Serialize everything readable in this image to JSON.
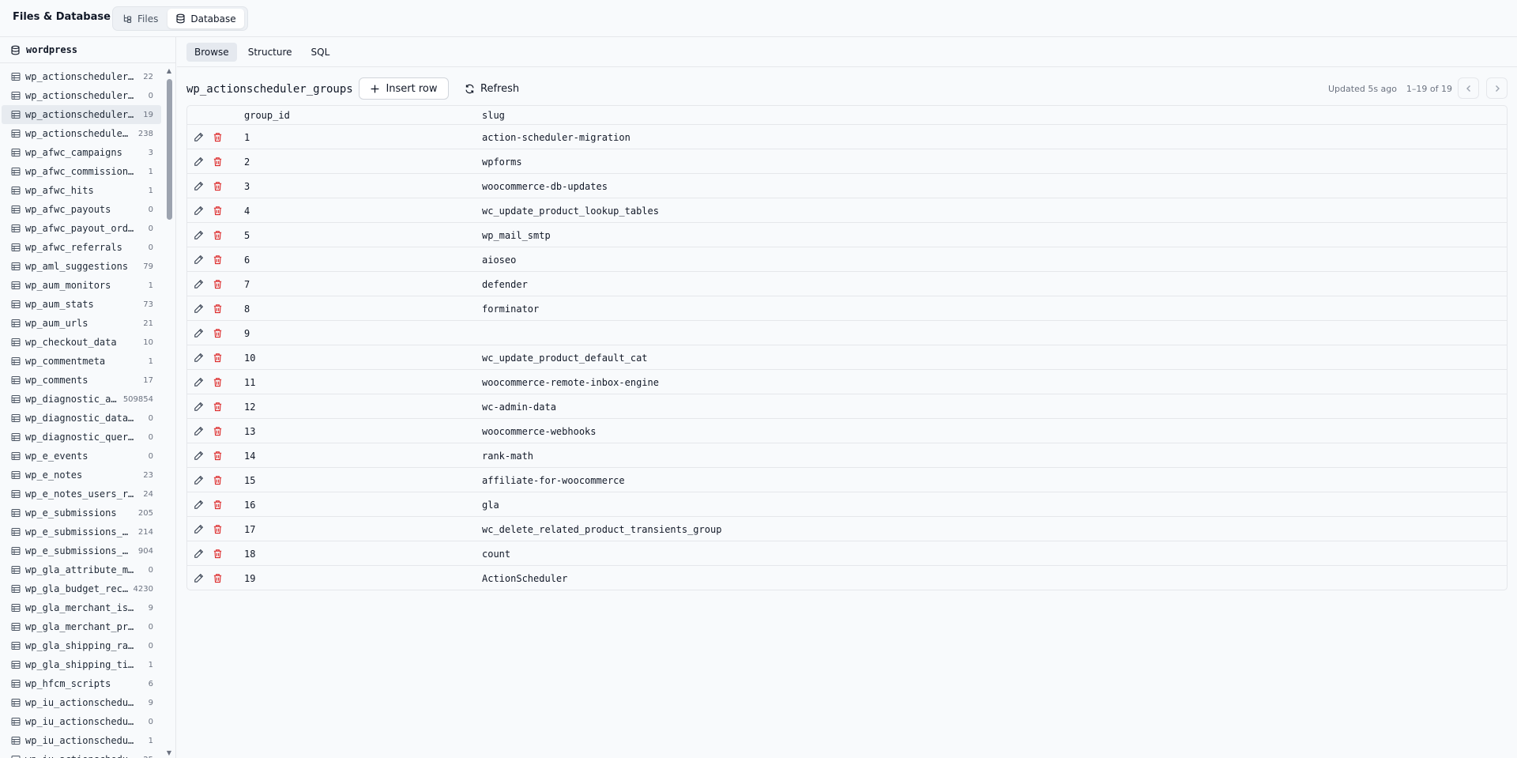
{
  "header": {
    "title": "Files & Database",
    "tabs": [
      {
        "label": "Files",
        "icon": "file-tree-icon",
        "active": false
      },
      {
        "label": "Database",
        "icon": "database-icon",
        "active": true
      }
    ]
  },
  "sidebar": {
    "database": "wordpress",
    "tables": [
      {
        "name": "wp_actionscheduler_actions",
        "count": "22"
      },
      {
        "name": "wp_actionscheduler_claims",
        "count": "0"
      },
      {
        "name": "wp_actionscheduler_groups",
        "count": "19",
        "active": true
      },
      {
        "name": "wp_actionscheduler_logs",
        "count": "238"
      },
      {
        "name": "wp_afwc_campaigns",
        "count": "3"
      },
      {
        "name": "wp_afwc_commission_plans",
        "count": "1"
      },
      {
        "name": "wp_afwc_hits",
        "count": "1"
      },
      {
        "name": "wp_afwc_payouts",
        "count": "0"
      },
      {
        "name": "wp_afwc_payout_orders",
        "count": "0"
      },
      {
        "name": "wp_afwc_referrals",
        "count": "0"
      },
      {
        "name": "wp_aml_suggestions",
        "count": "79"
      },
      {
        "name": "wp_aum_monitors",
        "count": "1"
      },
      {
        "name": "wp_aum_stats",
        "count": "73"
      },
      {
        "name": "wp_aum_urls",
        "count": "21"
      },
      {
        "name": "wp_checkout_data",
        "count": "10"
      },
      {
        "name": "wp_commentmeta",
        "count": "1"
      },
      {
        "name": "wp_comments",
        "count": "17"
      },
      {
        "name": "wp_diagnostic_actions",
        "count": "509854"
      },
      {
        "name": "wp_diagnostic_data_items",
        "count": "0"
      },
      {
        "name": "wp_diagnostic_queries",
        "count": "0"
      },
      {
        "name": "wp_e_events",
        "count": "0"
      },
      {
        "name": "wp_e_notes",
        "count": "23"
      },
      {
        "name": "wp_e_notes_users_relations",
        "count": "24"
      },
      {
        "name": "wp_e_submissions",
        "count": "205"
      },
      {
        "name": "wp_e_submissions_actions_log",
        "count": "214"
      },
      {
        "name": "wp_e_submissions_values",
        "count": "904"
      },
      {
        "name": "wp_gla_attribute_mapping_rules",
        "count": "0"
      },
      {
        "name": "wp_gla_budget_recommendations",
        "count": "4230"
      },
      {
        "name": "wp_gla_merchant_issues",
        "count": "9"
      },
      {
        "name": "wp_gla_merchant_price_benchmarks",
        "count": "0"
      },
      {
        "name": "wp_gla_shipping_rates",
        "count": "0"
      },
      {
        "name": "wp_gla_shipping_times",
        "count": "1"
      },
      {
        "name": "wp_hfcm_scripts",
        "count": "6"
      },
      {
        "name": "wp_iu_actionscheduler_actions",
        "count": "9"
      },
      {
        "name": "wp_iu_actionscheduler_claims",
        "count": "0"
      },
      {
        "name": "wp_iu_actionscheduler_groups",
        "count": "1"
      },
      {
        "name": "wp_iu_actionscheduler_logs",
        "count": "25"
      }
    ]
  },
  "main": {
    "subtabs": [
      "Browse",
      "Structure",
      "SQL"
    ],
    "active_subtab": "Browse",
    "table_name": "wp_actionscheduler_groups",
    "insert_label": "Insert row",
    "refresh_label": "Refresh",
    "updated": "Updated 5s ago",
    "range": "1–19 of 19",
    "columns": [
      "group_id",
      "slug"
    ],
    "rows": [
      [
        "1",
        "action-scheduler-migration"
      ],
      [
        "2",
        "wpforms"
      ],
      [
        "3",
        "woocommerce-db-updates"
      ],
      [
        "4",
        "wc_update_product_lookup_tables"
      ],
      [
        "5",
        "wp_mail_smtp"
      ],
      [
        "6",
        "aioseo"
      ],
      [
        "7",
        "defender"
      ],
      [
        "8",
        "forminator"
      ],
      [
        "9",
        ""
      ],
      [
        "10",
        "wc_update_product_default_cat"
      ],
      [
        "11",
        "woocommerce-remote-inbox-engine"
      ],
      [
        "12",
        "wc-admin-data"
      ],
      [
        "13",
        "woocommerce-webhooks"
      ],
      [
        "14",
        "rank-math"
      ],
      [
        "15",
        "affiliate-for-woocommerce"
      ],
      [
        "16",
        "gla"
      ],
      [
        "17",
        "wc_delete_related_product_transients_group"
      ],
      [
        "18",
        "count"
      ],
      [
        "19",
        "ActionScheduler"
      ]
    ]
  },
  "colors": {
    "delete": "#dc2626",
    "border": "#e5e7eb",
    "muted": "#6b7280"
  }
}
